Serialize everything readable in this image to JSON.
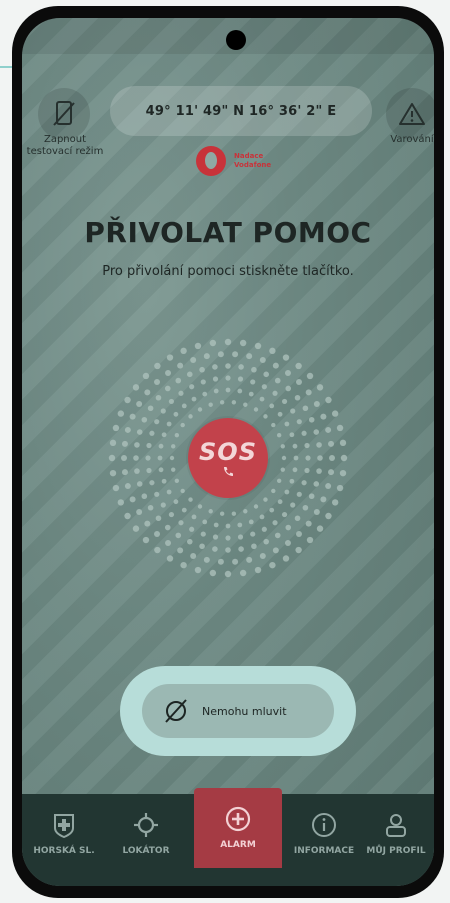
{
  "header": {
    "test_mode_label": "Zapnout testovací režim",
    "coordinates": "49° 11' 49\" N 16° 36' 2\" E",
    "warning_label": "Varování",
    "logo_text": "Nadace Vodafone"
  },
  "main": {
    "title": "PŘIVOLAT POMOC",
    "subtitle": "Pro přivolání pomoci stiskněte tlačítko.",
    "sos_label": "SOS",
    "cannot_speak_label": "Nemohu mluvit"
  },
  "nav": {
    "items": [
      {
        "label": "HORSKÁ SL.",
        "icon": "mountain-rescue-icon"
      },
      {
        "label": "LOKÁTOR",
        "icon": "locator-icon"
      },
      {
        "label": "ALARM",
        "icon": "plus-circle-icon"
      },
      {
        "label": "INFORMACE",
        "icon": "info-icon"
      },
      {
        "label": "MŮJ PROFIL",
        "icon": "profile-icon"
      }
    ],
    "active_index": 2
  },
  "colors": {
    "sos": "#c2424b",
    "nav_bg": "#223632",
    "nav_active": "#a53b44",
    "accent_light": "#b7ddd9"
  }
}
